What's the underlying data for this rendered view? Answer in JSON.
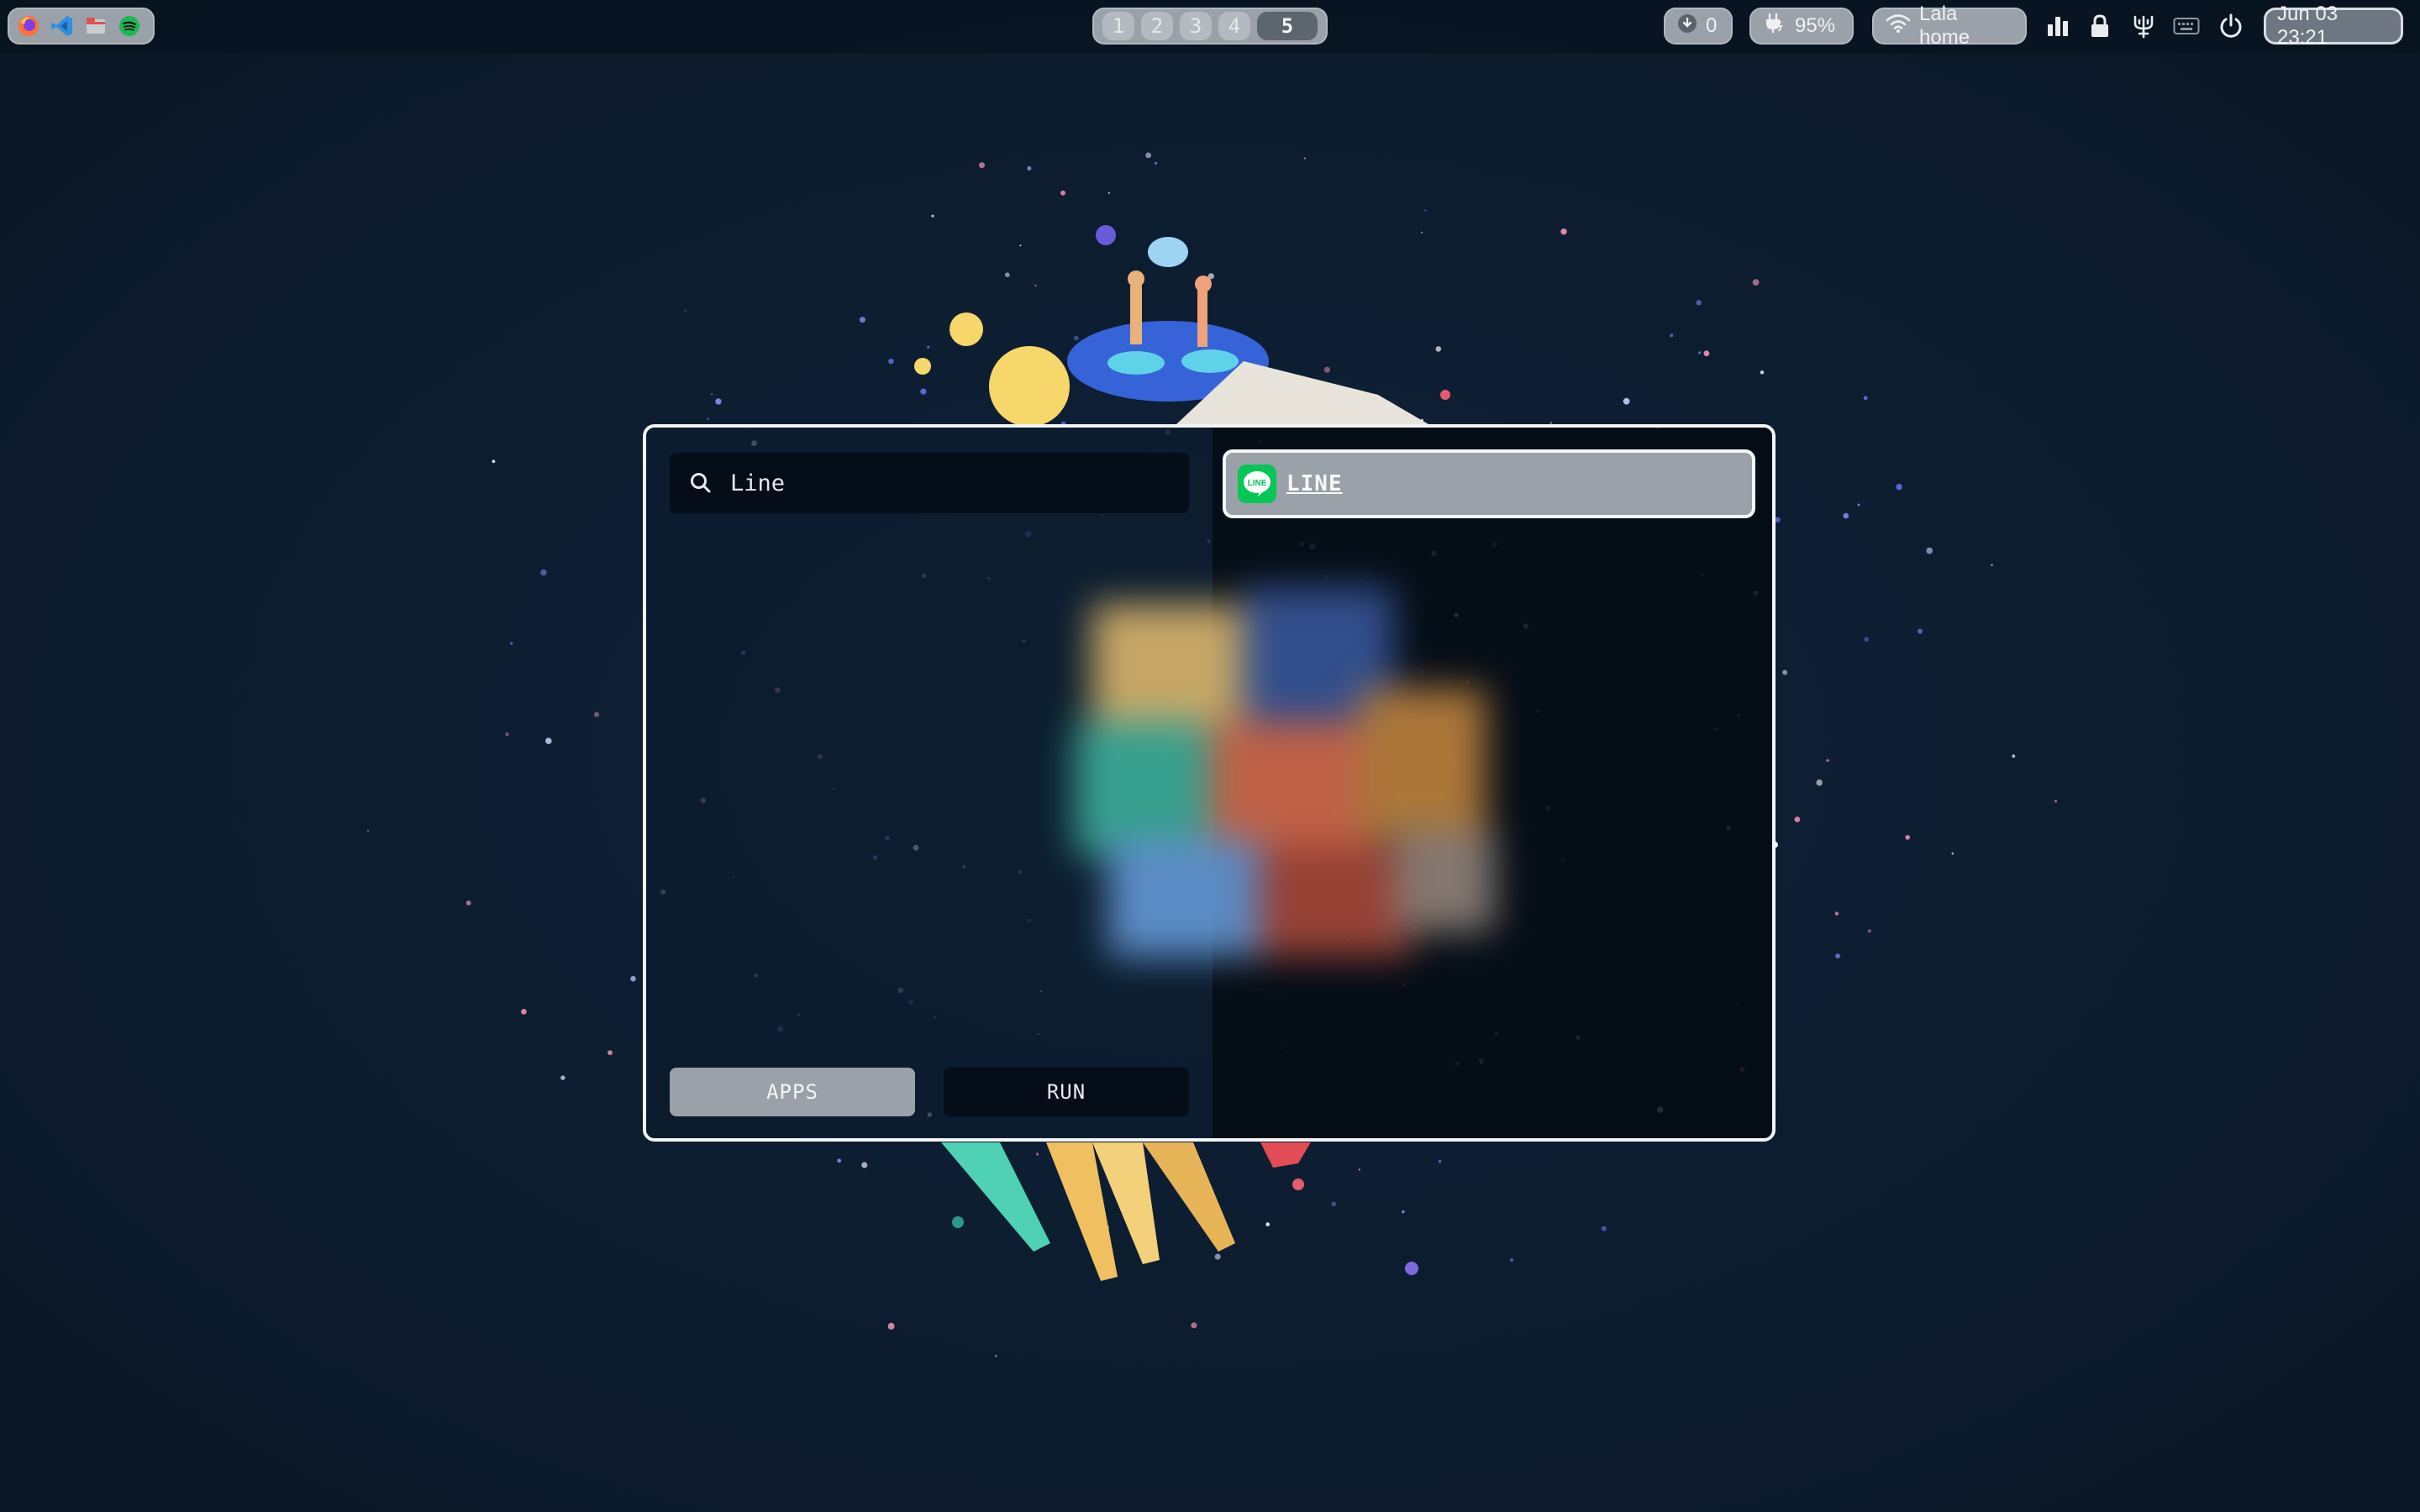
{
  "topbar": {
    "pinned_apps": [
      {
        "icon": "firefox-icon",
        "color": "#ff7139"
      },
      {
        "icon": "vscode-icon",
        "color": "#2f8fe0"
      },
      {
        "icon": "file-manager-icon",
        "color": "#d9534f"
      },
      {
        "icon": "spotify-icon",
        "color": "#1db954"
      }
    ],
    "workspaces": [
      {
        "label": "1",
        "active": false
      },
      {
        "label": "2",
        "active": false
      },
      {
        "label": "3",
        "active": false
      },
      {
        "label": "4",
        "active": false
      },
      {
        "label": "5",
        "active": true
      }
    ],
    "downloads": {
      "icon": "download-icon",
      "count": "0"
    },
    "battery": {
      "icon": "battery-charging-icon",
      "percent": "95%"
    },
    "wifi": {
      "icon": "wifi-icon",
      "ssid": "Lala home"
    },
    "tray_icons": [
      "bar-chart-icon",
      "lock-icon",
      "trident-icon",
      "keyboard-icon",
      "power-icon"
    ],
    "datetime": "Jun 03 23:21"
  },
  "launcher": {
    "search": {
      "value": "Line",
      "placeholder": ""
    },
    "results": [
      {
        "label": "LINE",
        "icon": "line-app-icon",
        "icon_color": "#06c755",
        "selected": true
      }
    ],
    "modes": [
      {
        "label": "APPS",
        "active": true
      },
      {
        "label": "RUN",
        "active": false
      }
    ]
  },
  "colors": {
    "background": "#0b1a2b",
    "pill": "#9aa1a8",
    "panel_border": "#f2f4f5",
    "line_green": "#06c755"
  }
}
